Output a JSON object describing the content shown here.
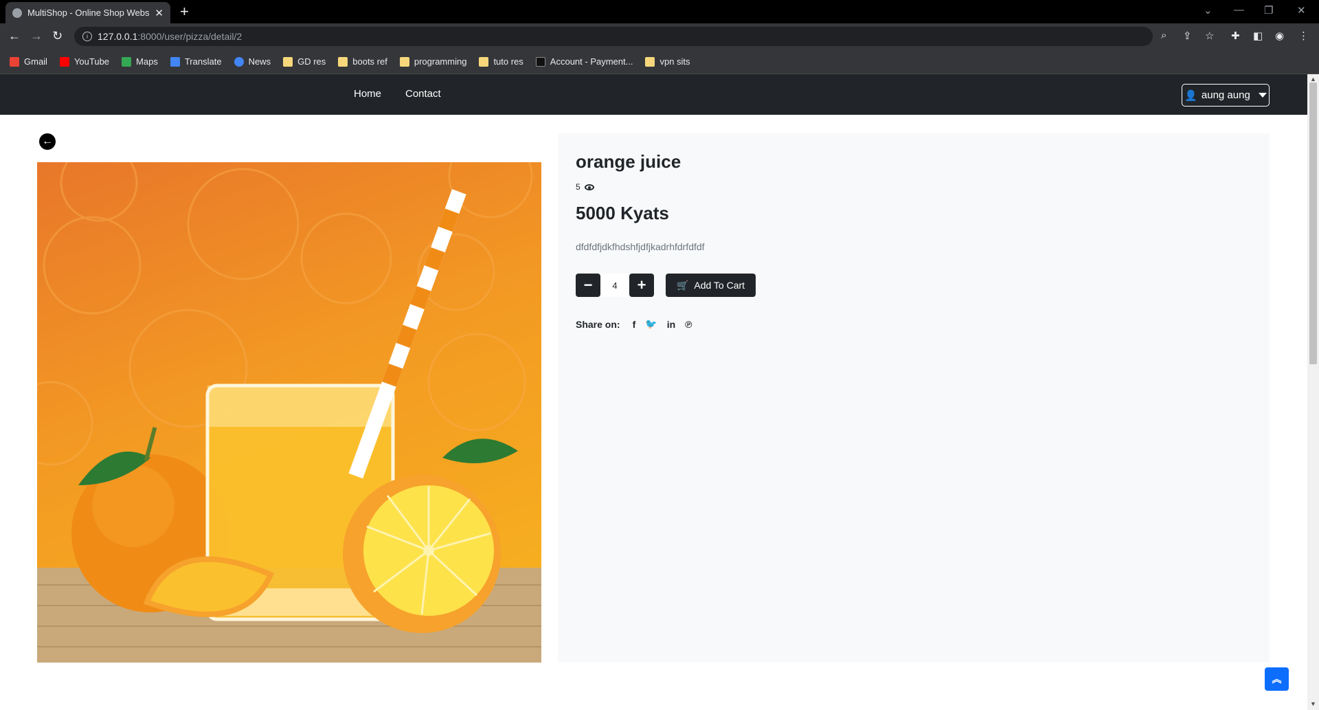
{
  "browser": {
    "tab_title": "MultiShop - Online Shop Website",
    "new_tab": "+",
    "url_host": "127.0.0.1",
    "url_path": ":8000/user/pizza/detail/2",
    "bookmarks": [
      {
        "label": "Gmail",
        "color": "#ea4335"
      },
      {
        "label": "YouTube",
        "color": "#ff0000"
      },
      {
        "label": "Maps",
        "color": "#34a853"
      },
      {
        "label": "Translate",
        "color": "#4285f4"
      },
      {
        "label": "News",
        "color": "#4285f4"
      },
      {
        "label": "GD res",
        "color": "#f6d77b"
      },
      {
        "label": "boots ref",
        "color": "#f6d77b"
      },
      {
        "label": "programming",
        "color": "#f6d77b"
      },
      {
        "label": "tuto res",
        "color": "#f6d77b"
      },
      {
        "label": "Account - Payment...",
        "color": "#111111"
      },
      {
        "label": "vpn sits",
        "color": "#f6d77b"
      }
    ]
  },
  "navbar": {
    "links": [
      "Home",
      "Contact"
    ],
    "user_label": "aung aung"
  },
  "product": {
    "name": "orange juice",
    "view_count": "5",
    "price": "5000 Kyats",
    "description": "dfdfdfjdkfhdshfjdfjkadrhfdrfdfdf",
    "quantity": "4",
    "add_to_cart": "Add To Cart",
    "share_label": "Share on:",
    "share_icons": [
      "facebook-icon",
      "twitter-icon",
      "linkedin-icon",
      "pinterest-icon"
    ]
  },
  "colors": {
    "navbar_bg": "#212529",
    "detail_bg": "#f8f9fa",
    "scroll_top_btn": "#0d6efd"
  }
}
